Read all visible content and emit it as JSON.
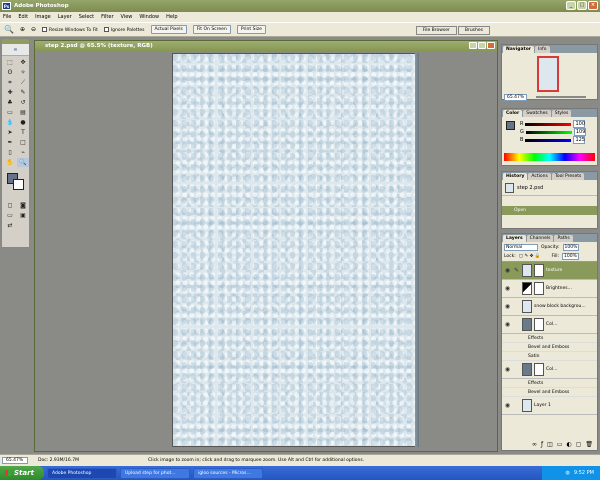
{
  "app_title": "Adobe Photoshop",
  "menu": [
    "File",
    "Edit",
    "Image",
    "Layer",
    "Select",
    "Filter",
    "View",
    "Window",
    "Help"
  ],
  "options": {
    "resize_label": "Resize Windows To Fit",
    "ignore_palettes_label": "Ignore Palettes",
    "actual_pixels": "Actual Pixels",
    "fit_on_screen": "Fit On Screen",
    "print_size": "Print Size"
  },
  "top_tabs": [
    "File Browser",
    "Brushes"
  ],
  "document": {
    "title": "step 2.psd @ 65.5% (texture, RGB)"
  },
  "status": {
    "zoom": "65.47%",
    "doc_info": "Doc: 2.93M/16.7M",
    "hint": "Click image to zoom in; click and drag to marquee zoom.  Use Alt and Ctrl for additional options."
  },
  "navigator": {
    "tabs": [
      "Navigator",
      "Info"
    ]
  },
  "color": {
    "tabs": [
      "Color",
      "Swatches",
      "Styles"
    ],
    "rows": [
      {
        "label": "R",
        "value": "100"
      },
      {
        "label": "G",
        "value": "109"
      },
      {
        "label": "B",
        "value": "125"
      }
    ]
  },
  "history": {
    "tabs": [
      "History",
      "Actions",
      "Tool Presets"
    ],
    "snapshot": "step 2.psd",
    "items": [
      "Open"
    ]
  },
  "layers": {
    "tabs": [
      "Layers",
      "Channels",
      "Paths"
    ],
    "blend_mode": "Normal",
    "opacity_label": "Opacity:",
    "opacity": "100%",
    "lock_label": "Lock:",
    "fill_label": "Fill:",
    "fill": "100%",
    "rows": [
      {
        "name": "texture",
        "selected": true
      },
      {
        "name": "Brightnes...",
        "selected": false
      },
      {
        "name": "snow block backgrou...",
        "selected": false
      },
      {
        "name": "Col...",
        "selected": false
      },
      {
        "name": "Effects",
        "sub": true
      },
      {
        "name": "Bevel and Emboss",
        "sub": true
      },
      {
        "name": "Satin",
        "sub": true
      },
      {
        "name": "Col...",
        "selected": false
      },
      {
        "name": "Effects",
        "sub": true
      },
      {
        "name": "Bevel and Emboss",
        "sub": true
      },
      {
        "name": "Layer 1",
        "selected": false
      }
    ]
  },
  "taskbar": {
    "start": "Start",
    "tasks": [
      "Adobe Photoshop",
      "Upload step for phot...",
      "igloo sources - Micros..."
    ],
    "clock": "9:52 PM"
  }
}
